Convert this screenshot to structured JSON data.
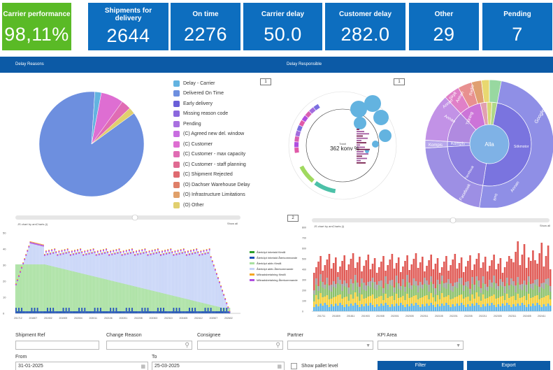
{
  "kpis": [
    {
      "label": "Carrier performance",
      "value": "98,11%"
    },
    {
      "label": "Shipments for delivery",
      "value": "2644"
    },
    {
      "label": "On time",
      "value": "2276"
    },
    {
      "label": "Carrier delay",
      "value": "50.0"
    },
    {
      "label": "Customer delay",
      "value": "282.0"
    },
    {
      "label": "Other",
      "value": "29"
    },
    {
      "label": "Pending",
      "value": "7"
    }
  ],
  "bar": {
    "left": "Delay Reasons",
    "right": "Delay Responsible"
  },
  "legend": [
    {
      "label": "Delay - Carrier",
      "color": "#63b3e0"
    },
    {
      "label": "Delivered On Time",
      "color": "#6d8fdf"
    },
    {
      "label": "Early delivery",
      "color": "#6a5fd8"
    },
    {
      "label": "Missing reason code",
      "color": "#8b68de"
    },
    {
      "label": "Pending",
      "color": "#a970e0"
    },
    {
      "label": "(C) Agreed new del. window",
      "color": "#c86ee0"
    },
    {
      "label": "(C) Customer",
      "color": "#de6ed2"
    },
    {
      "label": "(C) Customer - max capacity",
      "color": "#e06cb4"
    },
    {
      "label": "(C) Customer - staff planning",
      "color": "#e06a92"
    },
    {
      "label": "(C) Shipment Rejected",
      "color": "#df6a70"
    },
    {
      "label": "(O) Dachser Warehouse Delay",
      "color": "#df7f68"
    },
    {
      "label": "(O) Infrastructure Limitations",
      "color": "#e0a06a"
    },
    {
      "label": "(O) Other",
      "color": "#e1cf6e"
    }
  ],
  "box1": "1",
  "box2": "1",
  "box3": "2",
  "radial": {
    "total_label": "Totalt",
    "total_value": "362 konv %"
  },
  "sunburst": {
    "center": "Alla",
    "labels": [
      "Google",
      "Sökmotor",
      "Kompis",
      "Kompis",
      "Bing",
      "Annan",
      "Annan",
      "Facebook",
      "Facebook",
      "Tidning",
      "Radio",
      "Annan",
      "Skylt",
      "Annan"
    ]
  },
  "chart2_legend": [
    {
      "label": "Återköpt inbetald förstå",
      "color": "#2ca02c"
    },
    {
      "label": "Återköpt inbetald Återkommande",
      "color": "#1f4fb8"
    },
    {
      "label": "Återköpt aktiv förstå",
      "color": "#a8e0a0"
    },
    {
      "label": "Återköpt aktiv Återkommande",
      "color": "#c7d4f7"
    },
    {
      "label": "Månadsbetalning förstå",
      "color": "#f5a623"
    },
    {
      "label": "Månadsbetalning Återkommande",
      "color": "#b04ee0"
    }
  ],
  "chart_notes": {
    "left": "JS chart by amCharts (i)",
    "right": "JS chart by amCharts (i)",
    "show_all": "Show all"
  },
  "filters": {
    "shipment_ref": "Shipment Ref",
    "change_reason": "Change Reason",
    "consignee": "Consignee",
    "partner": "Partner",
    "kpi_area": "KPI Area",
    "from": "From",
    "from_value": "31-01-2025",
    "to": "To",
    "to_value": "25-03-2025",
    "pallet": "Show pallet level",
    "filter_btn": "Filter",
    "export_btn": "Export"
  },
  "chart_data": [
    {
      "type": "pie",
      "title": "",
      "labels": [
        "Delivered On Time",
        "Delay - Carrier",
        "(C) Customer",
        "(C) Customer - max capacity",
        "(O) Other"
      ],
      "values": [
        86,
        2,
        7,
        3,
        2
      ]
    },
    {
      "type": "bar",
      "x_ticks": [
        "201712",
        "201807",
        "201902",
        "201909",
        "202004",
        "202011",
        "202106",
        "202201",
        "202208",
        "202303",
        "202310",
        "202405",
        "202412",
        "202507",
        "202602"
      ],
      "ylim": [
        0,
        50
      ]
    },
    {
      "type": "bar",
      "x_ticks": [
        "201711",
        "201809",
        "201811",
        "201903",
        "201908",
        "202001",
        "202005",
        "202011",
        "202105",
        "202201",
        "202205",
        "202211",
        "202305",
        "202311",
        "202405",
        "202411"
      ],
      "ylim": [
        0,
        800
      ]
    }
  ]
}
